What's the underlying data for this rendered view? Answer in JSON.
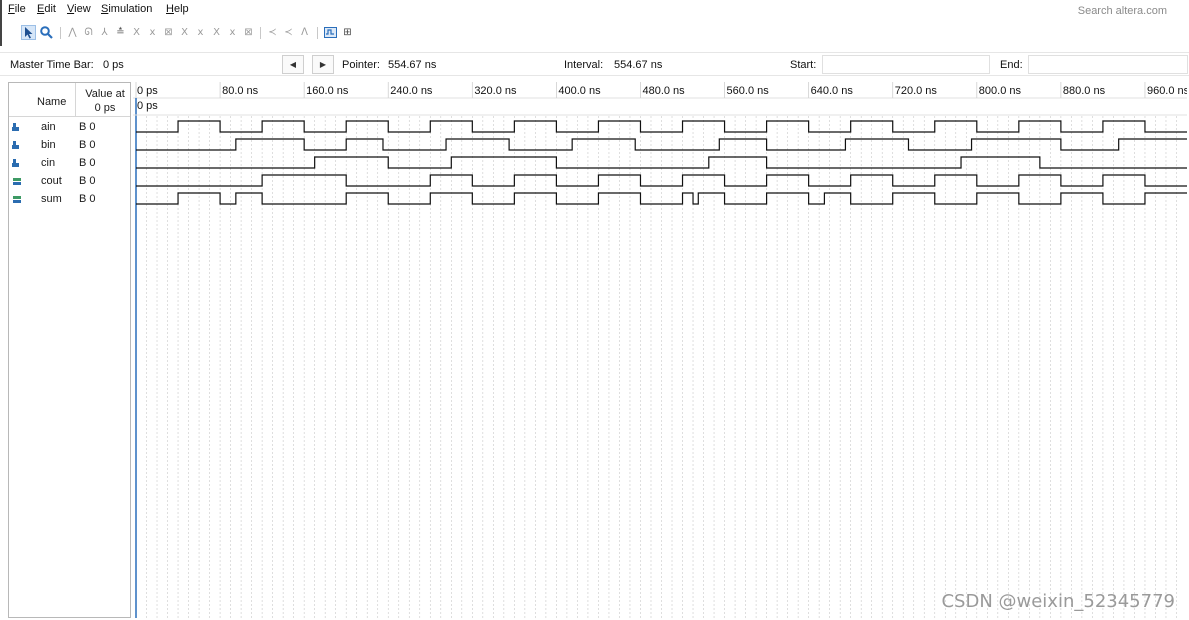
{
  "menu": {
    "file": {
      "u": "F",
      "rest": "ile"
    },
    "edit": {
      "u": "E",
      "rest": "dit"
    },
    "view": {
      "u": "V",
      "rest": "iew"
    },
    "simulation": {
      "u": "S",
      "rest": "imulation"
    },
    "help": {
      "u": "H",
      "rest": "elp"
    }
  },
  "search": {
    "placeholder": "Search altera.com"
  },
  "toolbar": {
    "icons": [
      "selection-tool-icon",
      "zoom-tool-icon",
      "node-tool-icon",
      "waveform-tool-icon",
      "forcing-low-icon",
      "forcing-high-icon",
      "clock-value-icon",
      "count-value-icon",
      "random-value-icon",
      "invert-value-icon",
      "weak-low-icon",
      "weak-high-icon",
      "unknown-value-icon",
      "high-impedance-icon",
      "dont-care-icon",
      "snap-icon",
      "grid-icon",
      "functional-sim-icon",
      "timing-sim-icon"
    ]
  },
  "timebar": {
    "master_label": "Master Time Bar:",
    "master_value": "0 ps",
    "pointer_label": "Pointer:",
    "pointer_value": "554.67 ns",
    "interval_label": "Interval:",
    "interval_value": "554.67 ns",
    "start_label": "Start:",
    "start_value": "",
    "end_label": "End:",
    "end_value": ""
  },
  "signals": {
    "header_name": "Name",
    "header_value_line1": "Value at",
    "header_value_line2": "0 ps",
    "rows": [
      {
        "name": "ain",
        "value": "B 0",
        "kind": "input"
      },
      {
        "name": "bin",
        "value": "B 0",
        "kind": "input"
      },
      {
        "name": "cin",
        "value": "B 0",
        "kind": "input"
      },
      {
        "name": "cout",
        "value": "B 0",
        "kind": "output"
      },
      {
        "name": "sum",
        "value": "B 0",
        "kind": "output"
      }
    ]
  },
  "timeline": {
    "ticks": [
      "0 ps",
      "80.0 ns",
      "160.0 ns",
      "240.0 ns",
      "320.0 ns",
      "400.0 ns",
      "480.0 ns",
      "560.0 ns",
      "640.0 ns",
      "720.0 ns",
      "800.0 ns",
      "880.0 ns",
      "960.0 ns"
    ],
    "tick_ns": [
      0,
      80,
      160,
      240,
      320,
      400,
      480,
      560,
      640,
      720,
      800,
      880,
      960
    ],
    "range_ns": [
      0,
      1000
    ],
    "master_marker": "0 ps"
  },
  "waveforms": [
    {
      "name": "ain",
      "transitions": [
        [
          0,
          0
        ],
        [
          40,
          1
        ],
        [
          80,
          0
        ],
        [
          120,
          1
        ],
        [
          160,
          0
        ],
        [
          200,
          1
        ],
        [
          240,
          0
        ],
        [
          280,
          1
        ],
        [
          320,
          0
        ],
        [
          360,
          1
        ],
        [
          400,
          0
        ],
        [
          440,
          1
        ],
        [
          480,
          0
        ],
        [
          520,
          1
        ],
        [
          560,
          0
        ],
        [
          600,
          1
        ],
        [
          640,
          0
        ],
        [
          680,
          1
        ],
        [
          720,
          0
        ],
        [
          760,
          1
        ],
        [
          800,
          0
        ],
        [
          840,
          1
        ],
        [
          880,
          0
        ],
        [
          920,
          1
        ],
        [
          960,
          0
        ]
      ]
    },
    {
      "name": "bin",
      "transitions": [
        [
          0,
          0
        ],
        [
          95,
          1
        ],
        [
          160,
          0
        ],
        [
          200,
          1
        ],
        [
          235,
          0
        ],
        [
          295,
          1
        ],
        [
          355,
          0
        ],
        [
          415,
          1
        ],
        [
          475,
          0
        ],
        [
          555,
          1
        ],
        [
          600,
          0
        ],
        [
          675,
          1
        ],
        [
          735,
          0
        ],
        [
          795,
          1
        ],
        [
          880,
          0
        ],
        [
          935,
          1
        ]
      ]
    },
    {
      "name": "cin",
      "transitions": [
        [
          0,
          0
        ],
        [
          170,
          1
        ],
        [
          240,
          0
        ],
        [
          300,
          1
        ],
        [
          400,
          0
        ],
        [
          545,
          1
        ],
        [
          600,
          0
        ],
        [
          785,
          1
        ],
        [
          860,
          0
        ]
      ]
    },
    {
      "name": "cout",
      "transitions": [
        [
          0,
          0
        ],
        [
          120,
          1
        ],
        [
          200,
          0
        ],
        [
          280,
          1
        ],
        [
          320,
          0
        ],
        [
          360,
          1
        ],
        [
          400,
          0
        ],
        [
          440,
          1
        ],
        [
          480,
          0
        ],
        [
          520,
          1
        ],
        [
          560,
          0
        ],
        [
          600,
          1
        ],
        [
          640,
          0
        ],
        [
          680,
          1
        ],
        [
          720,
          0
        ],
        [
          760,
          1
        ],
        [
          800,
          0
        ],
        [
          840,
          1
        ],
        [
          880,
          0
        ],
        [
          920,
          1
        ],
        [
          960,
          0
        ]
      ]
    },
    {
      "name": "sum",
      "transitions": [
        [
          0,
          0
        ],
        [
          40,
          1
        ],
        [
          80,
          0
        ],
        [
          95,
          1
        ],
        [
          120,
          0
        ],
        [
          200,
          1
        ],
        [
          240,
          0
        ],
        [
          280,
          1
        ],
        [
          320,
          0
        ],
        [
          360,
          1
        ],
        [
          400,
          0
        ],
        [
          440,
          1
        ],
        [
          480,
          0
        ],
        [
          520,
          1
        ],
        [
          530,
          0
        ],
        [
          535,
          1
        ],
        [
          560,
          0
        ],
        [
          600,
          1
        ],
        [
          640,
          0
        ],
        [
          655,
          1
        ],
        [
          680,
          0
        ],
        [
          720,
          1
        ],
        [
          760,
          0
        ],
        [
          800,
          1
        ],
        [
          840,
          0
        ],
        [
          880,
          1
        ],
        [
          920,
          0
        ],
        [
          960,
          1
        ]
      ]
    }
  ],
  "watermark": "CSDN @weixin_52345779",
  "colors": {
    "wave": "#111111",
    "grid": "#c8c8c8",
    "marker": "#2a6ebb",
    "input_icon": "#2b6cb0",
    "output_icon": "#3d9a64"
  }
}
